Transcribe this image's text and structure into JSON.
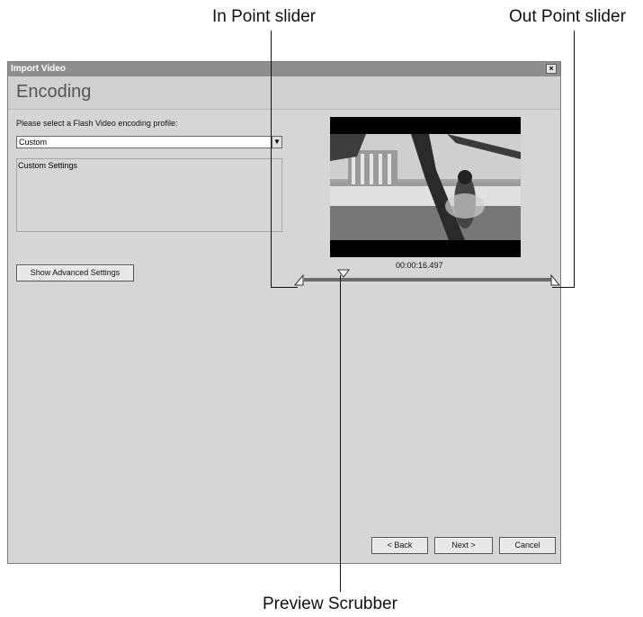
{
  "callouts": {
    "in_point": "In Point slider",
    "out_point": "Out Point slider",
    "scrubber": "Preview Scrubber"
  },
  "window": {
    "title": "Import Video",
    "close": "×",
    "heading": "Encoding",
    "profile_label": "Please select a Flash Video encoding profile:",
    "profile_value": "Custom",
    "settings_label": "Custom Settings",
    "advanced_button": "Show Advanced Settings",
    "timecode": "00:00:16.497",
    "scrubber_position": 0.16,
    "buttons": {
      "back": "< Back",
      "next": "Next >",
      "cancel": "Cancel"
    }
  },
  "icons": {
    "dropdown": "chevron-down-icon",
    "in_handle": "in-point-handle-icon",
    "out_handle": "out-point-handle-icon",
    "scrubber": "scrubber-triangle-icon"
  },
  "colors": {
    "titlebar": "#8e8e8e",
    "window_bg": "#d6d6d6",
    "track": "#6c6c6c"
  }
}
